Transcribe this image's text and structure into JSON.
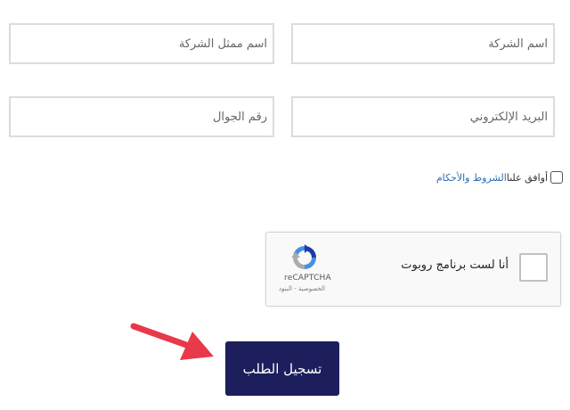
{
  "form": {
    "company_name_placeholder": "اسم الشركة",
    "representative_name_placeholder": "اسم ممثل الشركة",
    "email_placeholder": "البريد الإلكتروني",
    "mobile_placeholder": "رقم الجوال"
  },
  "terms": {
    "prefix": "أوافق علىا",
    "link_text": "الشروط والأحكام",
    "link_color": "#2d6eb5"
  },
  "recaptcha": {
    "label": "أنا لست برنامج روبوت",
    "brand": "reCAPTCHA",
    "links": "الخصوصية - البنود",
    "icon": "recaptcha-logo-icon"
  },
  "submit": {
    "label": "تسجيل الطلب",
    "background": "#1c1f5c"
  },
  "annotation": {
    "icon": "arrow-right-icon",
    "color": "#e8394a"
  }
}
